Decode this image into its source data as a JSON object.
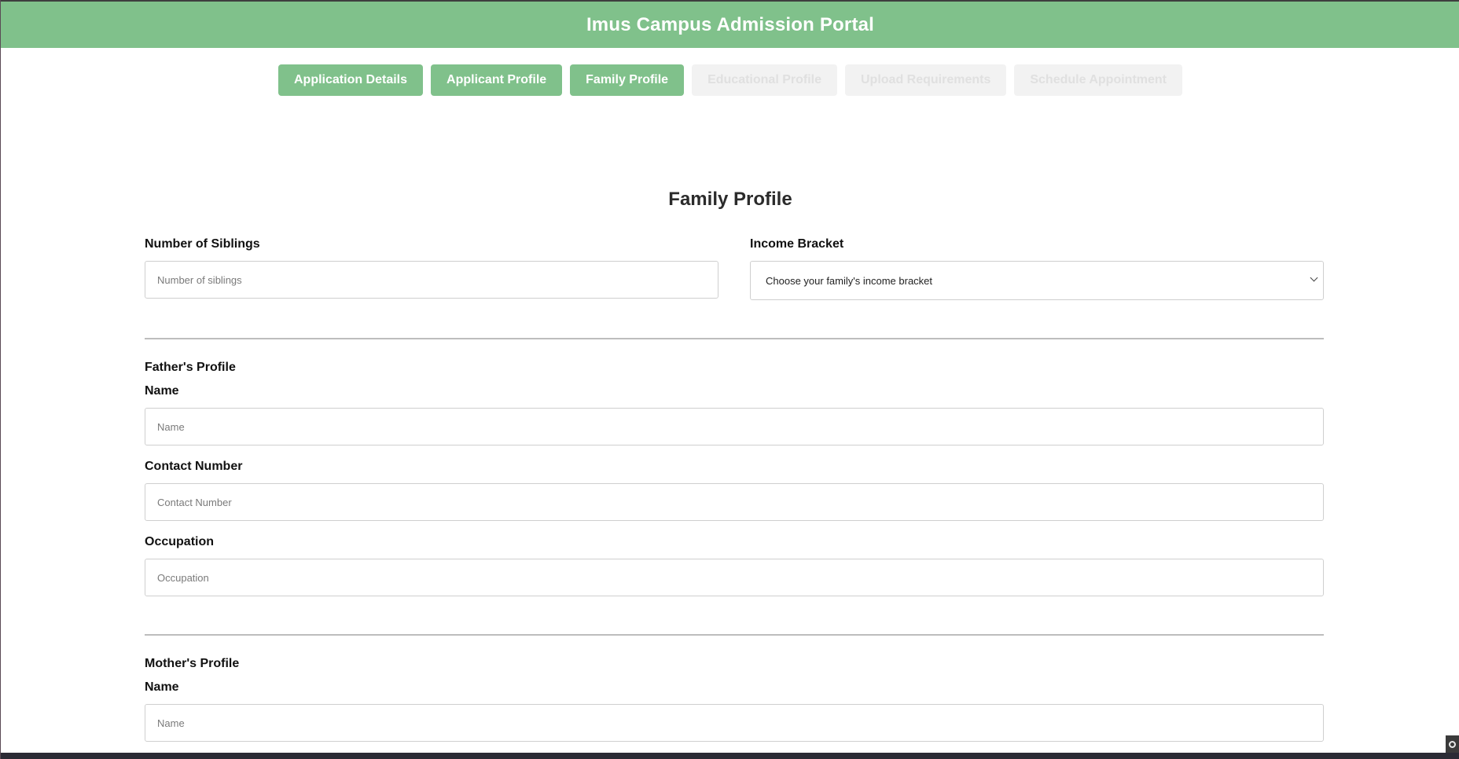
{
  "header": {
    "title": "Imus Campus Admission Portal"
  },
  "tabs": [
    {
      "label": "Application Details",
      "state": "active"
    },
    {
      "label": "Applicant Profile",
      "state": "active"
    },
    {
      "label": "Family Profile",
      "state": "active"
    },
    {
      "label": "Educational Profile",
      "state": "disabled"
    },
    {
      "label": "Upload Requirements",
      "state": "disabled"
    },
    {
      "label": "Schedule Appointment",
      "state": "disabled"
    }
  ],
  "colors": {
    "accent": "#80c18b",
    "disabled_tab": "#f2f2f2"
  },
  "form": {
    "title": "Family Profile",
    "siblings": {
      "label": "Number of Siblings",
      "placeholder": "Number of siblings",
      "value": ""
    },
    "income": {
      "label": "Income Bracket",
      "selected": "Choose your family's income bracket"
    },
    "father": {
      "heading": "Father's Profile",
      "name_label": "Name",
      "name_placeholder": "Name",
      "contact_label": "Contact Number",
      "contact_placeholder": "Contact Number",
      "occupation_label": "Occupation",
      "occupation_placeholder": "Occupation"
    },
    "mother": {
      "heading": "Mother's Profile",
      "name_label": "Name",
      "name_placeholder": "Name"
    }
  }
}
